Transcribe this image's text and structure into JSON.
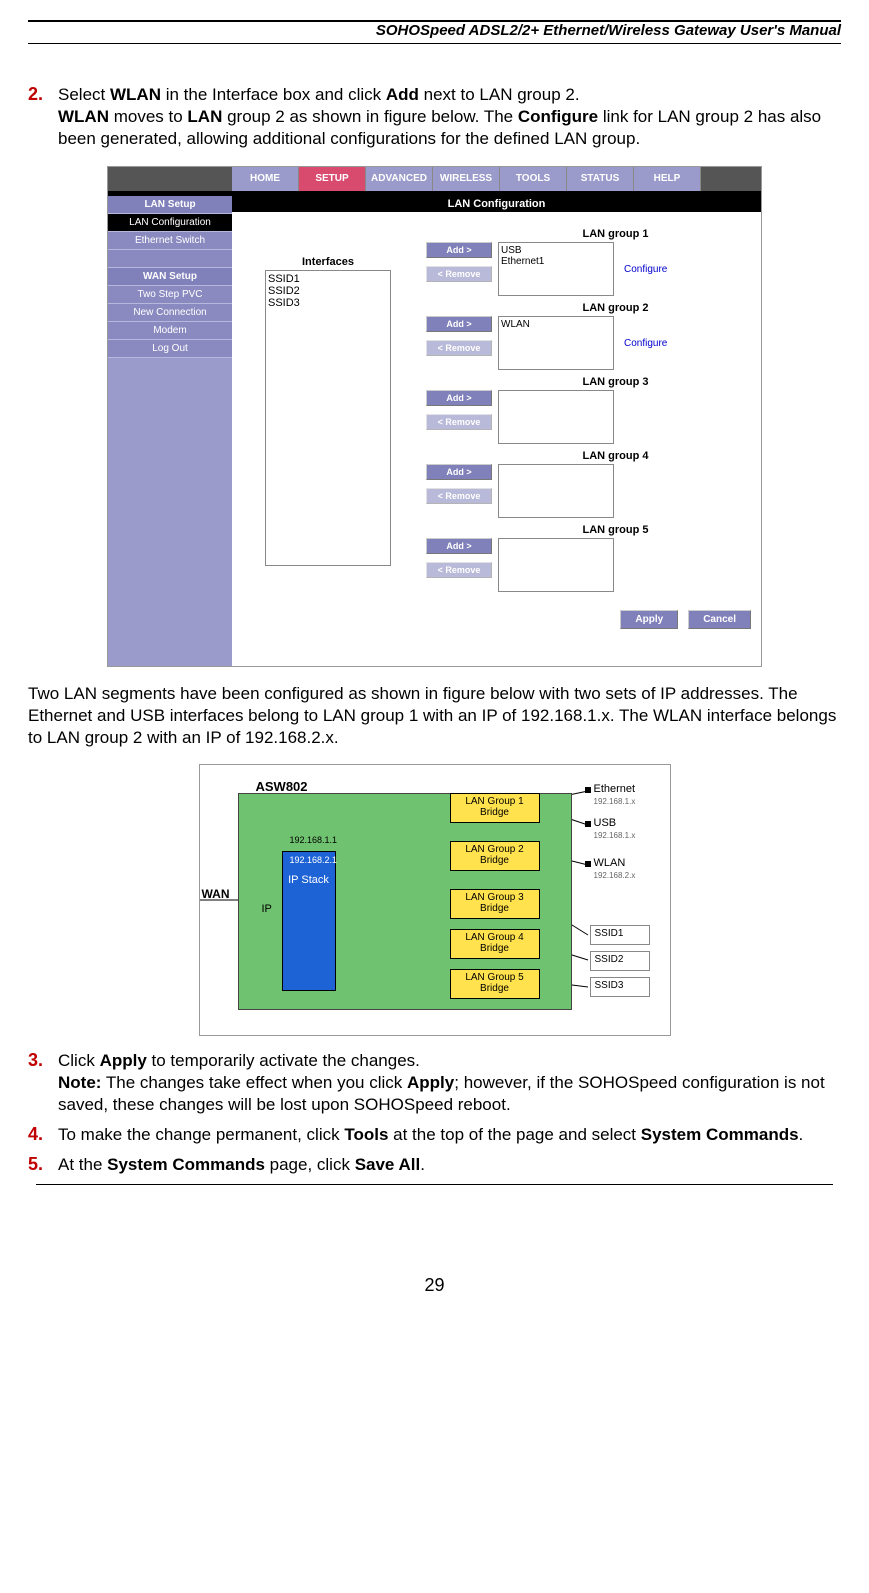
{
  "header_title": "SOHOSpeed ADSL2/2+ Ethernet/Wireless Gateway User's Manual",
  "page_number": "29",
  "steps": {
    "s2": {
      "num": "2.",
      "part1": "Select ",
      "b1": "WLAN",
      "part2": " in the Interface box and click ",
      "b2": "Add",
      "part3": " next to LAN group 2.",
      "line2a": "WLAN",
      "line2b": " moves to ",
      "line2c": "LAN",
      "line2d": " group 2 as shown in figure below. The ",
      "line2e": "Configure",
      "line2f": " link for LAN group 2 has also been generated, allowing additional configurations for the defined LAN group."
    },
    "s3": {
      "num": "3.",
      "p1": "Click ",
      "b1": "Apply",
      "p2": " to temporarily activate the changes.",
      "note_label": "Note:",
      "note_body1": " The changes take effect when you click ",
      "note_b": "Apply",
      "note_body2": "; however, if the SOHOSpeed configuration is not saved, these changes will be lost upon SOHOSpeed reboot."
    },
    "s4": {
      "num": "4.",
      "p1": "To make the change permanent, click ",
      "b1": "Tools",
      "p2": " at the top of the page and select ",
      "b2": "System Commands",
      "p3": "."
    },
    "s5": {
      "num": "5.",
      "p1": "At the ",
      "b1": "System Commands",
      "p2": " page, click ",
      "b2": "Save All",
      "p3": "."
    }
  },
  "mid_para": "Two LAN segments have been configured as shown in figure below with two sets of IP addresses. The Ethernet and USB interfaces belong to LAN group 1 with an IP of 192.168.1.x. The WLAN interface belongs to LAN group 2 with an IP of 192.168.2.x.",
  "shot1": {
    "tabs": [
      "HOME",
      "SETUP",
      "ADVANCED",
      "WIRELESS",
      "TOOLS",
      "STATUS",
      "HELP"
    ],
    "active_tab": 1,
    "sidebar": {
      "hdr1": "LAN Setup",
      "sel": "LAN Configuration",
      "eth": "Ethernet Switch",
      "hdr2": "WAN Setup",
      "tsp": "Two Step PVC",
      "nc": "New Connection",
      "modem": "Modem",
      "logout": "Log Out"
    },
    "main_title": "LAN Configuration",
    "interfaces_label": "Interfaces",
    "interfaces": [
      "SSID1",
      "SSID2",
      "SSID3"
    ],
    "groups": [
      {
        "title": "LAN group 1",
        "add": "Add >",
        "remove": "< Remove",
        "items": [
          "USB",
          "Ethernet1"
        ],
        "configure": "Configure"
      },
      {
        "title": "LAN group 2",
        "add": "Add >",
        "remove": "< Remove",
        "items": [
          "WLAN"
        ],
        "configure": "Configure"
      },
      {
        "title": "LAN group 3",
        "add": "Add >",
        "remove": "< Remove",
        "items": [],
        "configure": ""
      },
      {
        "title": "LAN group 4",
        "add": "Add >",
        "remove": "< Remove",
        "items": [],
        "configure": ""
      },
      {
        "title": "LAN group 5",
        "add": "Add >",
        "remove": "< Remove",
        "items": [],
        "configure": ""
      }
    ],
    "apply": "Apply",
    "cancel": "Cancel"
  },
  "shot2": {
    "device": "ASW802",
    "wan": "WAN",
    "ip": "IP",
    "ip_top": "192.168.1.1",
    "ip_inside": "192.168.2.1",
    "ipstack": "IP Stack",
    "bridges": [
      "LAN Group 1 Bridge",
      "LAN Group 2 Bridge",
      "LAN Group 3 Bridge",
      "LAN Group 4 Bridge",
      "LAN Group 5 Bridge"
    ],
    "right": {
      "eth": "Ethernet",
      "eth_ip": "192.168.1.x",
      "usb": "USB",
      "usb_ip": "192.168.1.x",
      "wlan": "WLAN",
      "wlan_ip": "192.168.2.x",
      "ssid1": "SSID1",
      "ssid2": "SSID2",
      "ssid3": "SSID3"
    }
  }
}
